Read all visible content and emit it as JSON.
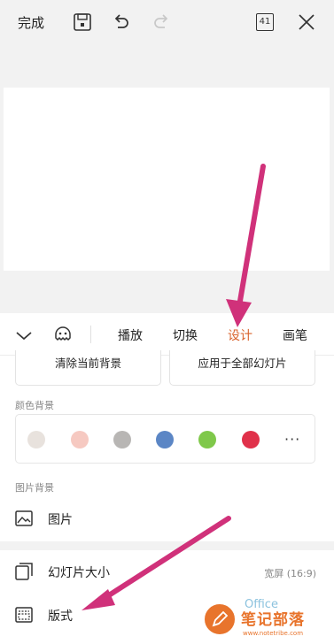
{
  "toolbar": {
    "done_label": "完成",
    "page_count": "41",
    "icons": [
      "save-icon",
      "undo-icon",
      "redo-icon",
      "page-count-icon",
      "close-icon"
    ]
  },
  "tabs": {
    "icons": [
      "collapse-chevron-icon",
      "emoji-icon"
    ],
    "items": [
      {
        "label": "播放",
        "active": false
      },
      {
        "label": "切换",
        "active": false
      },
      {
        "label": "设计",
        "active": true
      },
      {
        "label": "画笔",
        "active": false
      }
    ],
    "active_color": "#d9622b"
  },
  "design_panel": {
    "clear_background_label": "清除当前背景",
    "apply_all_label": "应用于全部幻灯片",
    "color_bg_label": "颜色背景",
    "swatches": [
      "#e8e2dd",
      "#f6c9c1",
      "#b8b6b4",
      "#5b86c5",
      "#7fc84a",
      "#e0314a"
    ],
    "more_label": "···",
    "image_bg_label": "图片背景",
    "picture_label": "图片",
    "slide_size_label": "幻灯片大小",
    "slide_size_value": "宽屏 (16:9)",
    "layout_label": "版式"
  },
  "watermark": {
    "title": "笔记部落",
    "url": "www.notetribe.com",
    "office_text": "Office"
  }
}
